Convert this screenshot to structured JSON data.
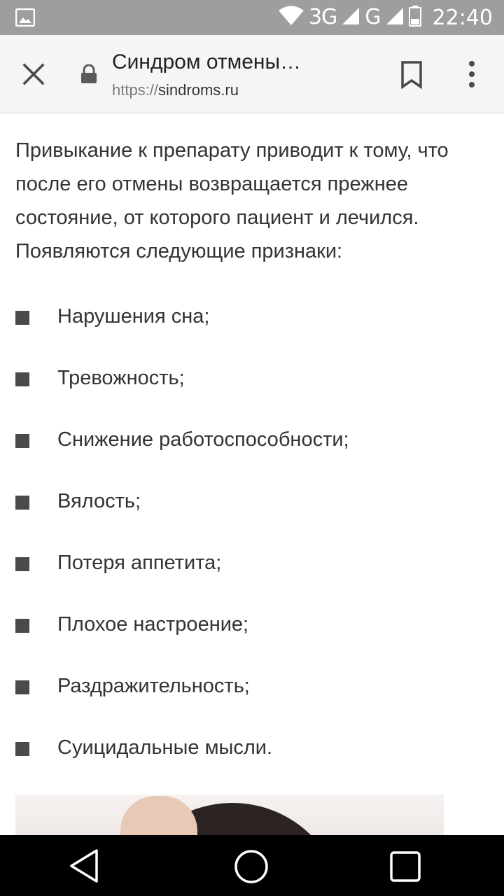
{
  "status_bar": {
    "network_label": "3G",
    "network_label_2": "G",
    "time": "22:40"
  },
  "toolbar": {
    "title": "Синдром отмены…",
    "url_scheme": "https://",
    "url_host": "sindroms.ru"
  },
  "article": {
    "intro": "Привыкание к препарату приводит к тому, что после его отмены возвращается прежнее состояние, от которого пациент и лечился. Появляются следующие признаки:",
    "symptoms": [
      "Нарушения сна;",
      "Тревожность;",
      "Снижение работоспособности;",
      "Вялость;",
      "Потеря аппетита;",
      "Плохое настроение;",
      "Раздражительность;",
      "Суицидальные мысли."
    ]
  },
  "icons": {
    "status_left": "image-notification-icon",
    "wifi": "wifi-icon",
    "signal": "cell-signal-icon",
    "battery": "battery-icon",
    "close": "close-icon",
    "lock": "lock-icon",
    "bookmark": "bookmark-icon",
    "menu": "more-vert-icon",
    "back": "back-icon",
    "home": "home-icon",
    "recents": "recents-icon"
  },
  "colors": {
    "status_bar": "#9e9e9e",
    "toolbar": "#f5f5f5",
    "text": "#333333",
    "bullet": "#4a4a4a",
    "nav_bar": "#000000"
  }
}
